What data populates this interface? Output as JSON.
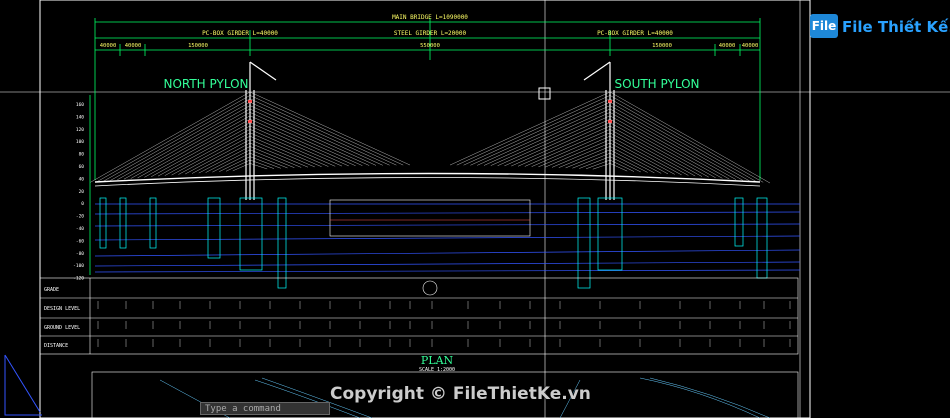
{
  "drawing": {
    "main_bridge": "MAIN BRIDGE L=1090000",
    "girders": {
      "north": "PC-BOX GIRDER L=40000",
      "steel": "STEEL GIRDER L=20000",
      "south": "PC-BOX GIRDER L=40000"
    },
    "pylons": {
      "north": "NORTH PYLON",
      "south": "SOUTH PYLON"
    },
    "dims_north": [
      "40000",
      "40000",
      "150000"
    ],
    "dims_mid": "550000",
    "dims_south": [
      "150000",
      "40000",
      "40000"
    ],
    "y_scale": [
      "160",
      "140",
      "120",
      "100",
      "80",
      "60",
      "40",
      "20",
      "0",
      "-20",
      "-40",
      "-60",
      "-80",
      "-100",
      "-120"
    ],
    "table_rows": [
      "GRADE",
      "DESIGN LEVEL",
      "GROUND LEVEL",
      "DISTANCE"
    ],
    "plan_title": "PLAN",
    "plan_scale": "SCALE 1:2000"
  },
  "brand": {
    "logo": "File",
    "name": "File Thiết Kế.vn"
  },
  "copyright": "Copyright © FileThietKe.vn",
  "cmd_placeholder": "Type a command",
  "colors": {
    "bg": "#000000",
    "frame": "#ffffff",
    "cable": "#ffffff",
    "dim": "#00ff66",
    "text": "#ffff66",
    "water": "#3355ff",
    "pile": "#00ffff",
    "title": "#33ff99"
  }
}
